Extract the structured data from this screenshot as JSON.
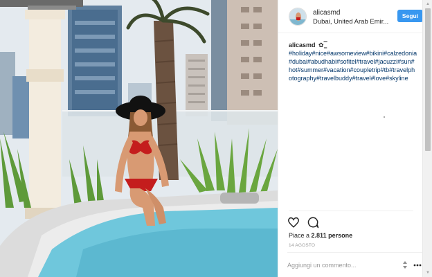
{
  "post": {
    "photo_alt": "Woman in red bikini and black sun hat sitting on the edge of a rooftop jacuzzi among city skyscrapers"
  },
  "header": {
    "username": "alicasmd",
    "location": "Dubai, United Arab Emir...",
    "follow_label": "Segui",
    "follow_color": "#3897f0"
  },
  "caption": {
    "username": "alicasmd",
    "flower": "✿ ͇̿",
    "hashtags": "#holiday#nice#awsomeview#bikini#calzedonia#dubai#abudhabi#sofitel#travel#jacuzzi#sun#hot#summer#vacation#coupletrip#tb#travelphotography#travelbuddy#travel#love#skyline",
    "hashtag_color": "#003569"
  },
  "actions": {
    "like_icon": "heart-outline",
    "comment_icon": "speech-bubble-outline",
    "likes_prefix": "Piace a",
    "likes_count": "2.811",
    "likes_suffix": "persone",
    "date": "14 AGOSTO"
  },
  "comment": {
    "placeholder": "Aggiungi un commento...",
    "sort_icon": "up-down-arrows",
    "more_icon": "ellipsis"
  },
  "scrollbar": {
    "up_glyph": "▲",
    "down_glyph": "▼"
  }
}
